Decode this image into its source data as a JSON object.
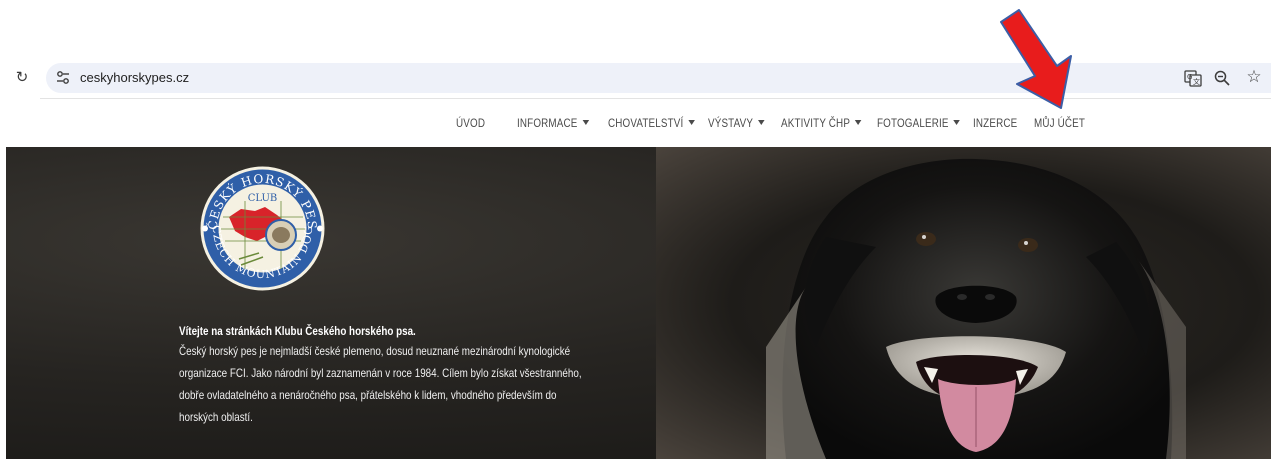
{
  "browser": {
    "url": "ceskyhorskypes.cz",
    "icons": [
      "reload-icon",
      "site-settings-icon",
      "translate-icon",
      "zoom-icon",
      "bookmark-star-icon"
    ]
  },
  "site_nav": {
    "items": [
      {
        "label": "ÚVOD",
        "has_dropdown": false
      },
      {
        "label": "INFORMACE",
        "has_dropdown": true
      },
      {
        "label": "CHOVATELSTVÍ",
        "has_dropdown": true
      },
      {
        "label": "VÝSTAVY",
        "has_dropdown": true
      },
      {
        "label": "AKTIVITY ČHP",
        "has_dropdown": true
      },
      {
        "label": "FOTOGALERIE",
        "has_dropdown": true
      },
      {
        "label": "INZERCE",
        "has_dropdown": false
      },
      {
        "label": "MŮJ ÚČET",
        "has_dropdown": false
      }
    ]
  },
  "logo": {
    "top_text": "ČESKÝ HORSKÝ PES",
    "center_text": "CLUB",
    "bottom_text": "CZECH MOUNTAIN DOG"
  },
  "hero": {
    "title": "Vítejte na stránkách Klubu Českého horského psa.",
    "lines": [
      "Český horský pes je nejmladší české plemeno, dosud neuznané mezinárodní kynologické",
      "organizace FCI. Jako národní byl zaznamenán v roce 1984. Cílem bylo získat všestranného,",
      "dobře ovladatelného a nenáročného psa, přátelského k lidem, vhodného především do",
      "horských oblastí."
    ]
  },
  "colors": {
    "annotation_arrow": "#e81c1c",
    "omnibox_bg": "#eef1f9",
    "nav_text": "#4a4a4a",
    "logo_ring": "#2f5fa8",
    "logo_map": "#d8232a"
  }
}
